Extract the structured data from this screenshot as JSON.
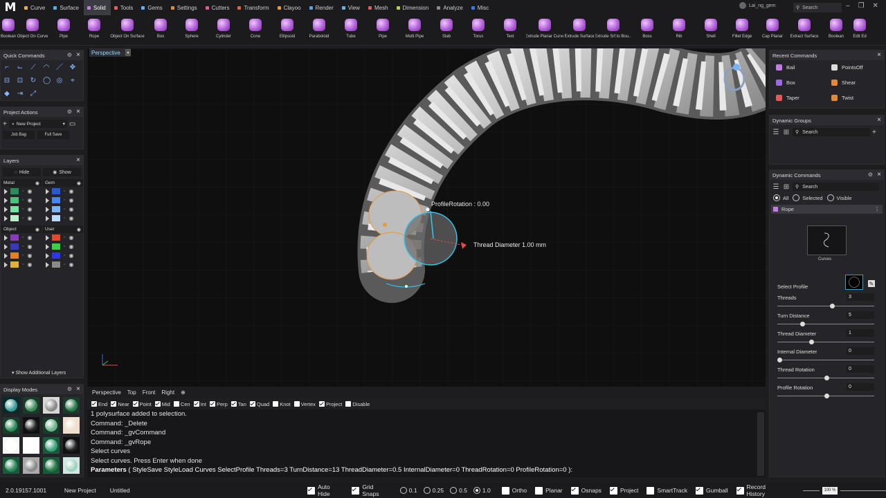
{
  "app": {
    "logo": "M",
    "status_version": "2.0.19157.1001",
    "status_project": "New Project",
    "status_file": "Untitled"
  },
  "tabs": [
    {
      "label": "Curve",
      "color": "#e8b14a"
    },
    {
      "label": "Surface",
      "color": "#4fb0e6"
    },
    {
      "label": "Solid",
      "color": "#c27be6",
      "active": true
    },
    {
      "label": "Tools",
      "color": "#e26060"
    },
    {
      "label": "Gems",
      "color": "#5fb3f0"
    },
    {
      "label": "Settings",
      "color": "#e08a3c"
    },
    {
      "label": "Cutters",
      "color": "#e25a9a"
    },
    {
      "label": "Transform",
      "color": "#d46a3a"
    },
    {
      "label": "Clayoo",
      "color": "#e89a3a"
    },
    {
      "label": "Render",
      "color": "#5aa0e0"
    },
    {
      "label": "View",
      "color": "#6ab0e0"
    },
    {
      "label": "Mesh",
      "color": "#e05a5a"
    },
    {
      "label": "Dimension",
      "color": "#b6d04a"
    },
    {
      "label": "Analyze",
      "color": "#8a8a8a"
    },
    {
      "label": "Misc",
      "color": "#3a7ae0"
    }
  ],
  "account": {
    "user": "Lai_ng_gem"
  },
  "top_search": {
    "placeholder": "Search"
  },
  "tools": [
    {
      "label": "Boolean",
      "w": 24
    },
    {
      "label": "Object On Curve",
      "w": 46
    },
    {
      "label": "Pipe",
      "w": 44
    },
    {
      "label": "Rope",
      "w": 44
    },
    {
      "label": "Object On Surface",
      "w": 52
    },
    {
      "label": "Box",
      "w": 44
    },
    {
      "label": "Sphere",
      "w": 46
    },
    {
      "label": "Cylinder",
      "w": 46
    },
    {
      "label": "Cone",
      "w": 46
    },
    {
      "label": "Ellipsoid",
      "w": 46
    },
    {
      "label": "Paraboloid",
      "w": 46
    },
    {
      "label": "Tube",
      "w": 46
    },
    {
      "label": "Pipe",
      "w": 46
    },
    {
      "label": "Multi Pipe",
      "w": 46
    },
    {
      "label": "Slab",
      "w": 46
    },
    {
      "label": "Torus",
      "w": 46
    },
    {
      "label": "Text",
      "w": 46
    },
    {
      "label": "Extrude Planar Curve",
      "w": 54
    },
    {
      "label": "Extrude Surface",
      "w": 46
    },
    {
      "label": "Extrude Srf to Bou...",
      "w": 52
    },
    {
      "label": "Boss",
      "w": 46
    },
    {
      "label": "Rib",
      "w": 46
    },
    {
      "label": "Shell",
      "w": 46
    },
    {
      "label": "Fillet Edge",
      "w": 44
    },
    {
      "label": "Cap Planar",
      "w": 44
    },
    {
      "label": "Extract Surface",
      "w": 48
    },
    {
      "label": "Boolean",
      "w": 44
    },
    {
      "label": "Edit Ed",
      "w": 24
    }
  ],
  "quick_commands": {
    "title": "Quick Commands",
    "icons": [
      "corner-icon",
      "curve-a-icon",
      "curve-b-icon",
      "arc-icon",
      "line-icon",
      "move-icon",
      "align-icon",
      "offset-icon",
      "rotate-icon",
      "circle-a-icon",
      "circle-b-icon",
      "snap-icon",
      "gem-icon",
      "extend-icon",
      "scale-icon"
    ]
  },
  "project_actions": {
    "title": "Project Actions",
    "new_project": "New Project",
    "job_bag": "Job Bag",
    "full_save": "Full Save"
  },
  "layers": {
    "title": "Layers",
    "hide": "Hide",
    "show": "Show",
    "groups": [
      {
        "name": "Metal",
        "colors": [
          "#2d8a5a",
          "#4fc07a",
          "#7ae0a0",
          "#b8f0c8"
        ]
      },
      {
        "name": "Gem",
        "colors": [
          "#2a5ad0",
          "#4a84f0",
          "#7ab2f8",
          "#b8dcff"
        ]
      },
      {
        "name": "Object",
        "colors": [
          "#8a3ac0",
          "#3a3ab8",
          "#e0802a",
          "#e0b03a"
        ]
      },
      {
        "name": "User",
        "colors": [
          "#e04a2a",
          "#3ad04a",
          "#2a3ae0",
          "#8a8a8a"
        ]
      }
    ],
    "show_additional": "Show Additional Layers"
  },
  "display_modes": {
    "title": "Display Modes",
    "modes": [
      {
        "bg": "#0a2a2a",
        "fill": "#3a9a9a"
      },
      {
        "bg": "#1a3a2a",
        "fill": "#3a8a5a"
      },
      {
        "bg": "#d8d8d8",
        "fill": "#888"
      },
      {
        "bg": "#1a3a2a",
        "fill": "#2a7a4a"
      },
      {
        "bg": "#1a3a2a",
        "fill": "#2a8a5a"
      },
      {
        "bg": "#111",
        "fill": "#222"
      },
      {
        "bg": "#1a3a2a",
        "fill": "#6ab08a"
      },
      {
        "bg": "#f0e0d0",
        "fill": "#f0e0d0"
      },
      {
        "bg": "#f5f5f5",
        "fill": "#fff"
      },
      {
        "bg": "#fff",
        "fill": "#fff"
      },
      {
        "bg": "#1a5a3a",
        "fill": "#3aa07a"
      },
      {
        "bg": "#111",
        "fill": "#222"
      },
      {
        "bg": "#1a5a3a",
        "fill": "#2a8a5a"
      },
      {
        "bg": "#aaa",
        "fill": "#888"
      },
      {
        "bg": "#1a5a3a",
        "fill": "#2a7a4a"
      },
      {
        "bg": "#d0e8e0",
        "fill": "#a0d0c0"
      }
    ]
  },
  "viewport": {
    "name": "Perspective",
    "profile_rotation": "ProfileRotation : 0.00",
    "thread_diameter": "Thread Diameter 1.00 mm"
  },
  "view_tabs": [
    "Perspective",
    "Top",
    "Front",
    "Right"
  ],
  "osnaps": [
    {
      "label": "End",
      "on": true
    },
    {
      "label": "Near",
      "on": true
    },
    {
      "label": "Point",
      "on": true
    },
    {
      "label": "Mid",
      "on": true
    },
    {
      "label": "Cen",
      "on": false
    },
    {
      "label": "Int",
      "on": true
    },
    {
      "label": "Perp",
      "on": true
    },
    {
      "label": "Tan",
      "on": true
    },
    {
      "label": "Quad",
      "on": true
    },
    {
      "label": "Knot",
      "on": false
    },
    {
      "label": "Vertex",
      "on": false
    },
    {
      "label": "Project",
      "on": true
    },
    {
      "label": "Disable",
      "on": false
    }
  ],
  "command_history": [
    "1 polysurface added to selection.",
    "Command: _Delete",
    "Command: _gvCommand",
    "Command: _gvRope",
    "Select curves",
    "Select curves. Press Enter when done"
  ],
  "command_params": {
    "head": "Parameters",
    "body": " ( StyleSave  StyleLoad  Curves  SelectProfile  Threads=3  TurnDistance=13  ThreadDiameter=0.5  InternalDiameter=0  ThreadRotation=0  ProfileRotation=0 ):"
  },
  "recent_commands": {
    "title": "Recent Commands",
    "items": [
      {
        "label": "Bail",
        "col": "left"
      },
      {
        "label": "PointsOff",
        "col": "right"
      },
      {
        "label": "Box",
        "col": "left"
      },
      {
        "label": "Shear",
        "col": "right"
      },
      {
        "label": "Taper",
        "col": "left"
      },
      {
        "label": "Twist",
        "col": "right"
      }
    ]
  },
  "dynamic_groups": {
    "title": "Dynamic Groups",
    "search": "Search"
  },
  "dynamic_commands": {
    "title": "Dynamic Commands",
    "search": "Search",
    "filters": [
      "All",
      "Selected",
      "Visible"
    ],
    "active_filter": "All",
    "command": "Rope",
    "curves_label": "Curves",
    "select_profile": "Select Profile"
  },
  "params": [
    {
      "label": "Threads",
      "value": "3",
      "pos": 0.56
    },
    {
      "label": "Turn Distance",
      "value": "5",
      "pos": 0.24
    },
    {
      "label": "Thread Diameter",
      "value": "1",
      "pos": 0.34
    },
    {
      "label": "Internal Diameter",
      "value": "0",
      "pos": 0.0
    },
    {
      "label": "Thread Rotation",
      "value": "0",
      "pos": 0.5
    },
    {
      "label": "Profile Rotation",
      "value": "0",
      "pos": 0.5
    }
  ],
  "statusbar": {
    "toggles": [
      {
        "label": "Auto Hide",
        "on": true
      },
      {
        "label": "Grid Snaps",
        "on": true
      }
    ],
    "grid_values": [
      "0.1",
      "0.25",
      "0.5",
      "1.0"
    ],
    "grid_selected": "1.0",
    "toggles2": [
      {
        "label": "Ortho",
        "on": false
      },
      {
        "label": "Planar",
        "on": false
      },
      {
        "label": "Osnaps",
        "on": true
      },
      {
        "label": "Project",
        "on": true
      },
      {
        "label": "SmartTrack",
        "on": false
      },
      {
        "label": "Gumball",
        "on": true
      },
      {
        "label": "Record History",
        "on": true
      }
    ],
    "zoom": "100 %"
  }
}
